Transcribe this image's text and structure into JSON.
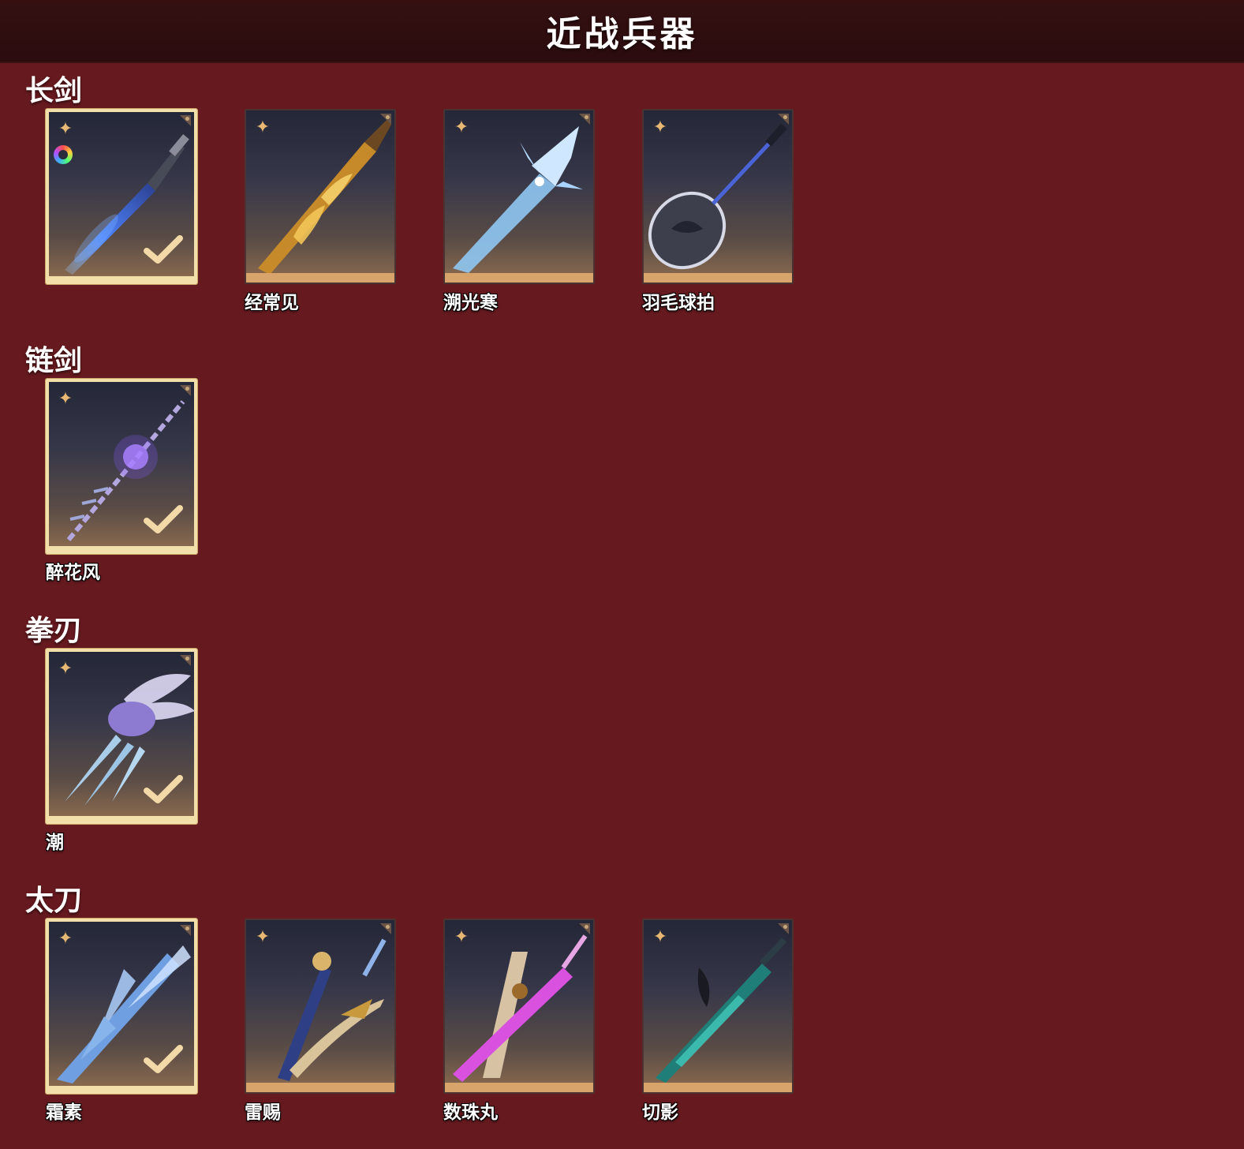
{
  "header": {
    "title": "近战兵器"
  },
  "sections": {
    "longsword": {
      "title": "长剑",
      "items": {
        "0": {
          "name": "",
          "icon": "blue-energy-sword-icon",
          "equipped": true,
          "variant_icon": "color-ring-icon"
        },
        "1": {
          "name": "经常见",
          "icon": "golden-script-sword-icon",
          "equipped": false
        },
        "2": {
          "name": "溯光寒",
          "icon": "ice-crystal-sword-icon",
          "equipped": false
        },
        "3": {
          "name": "羽毛球拍",
          "icon": "badminton-racket-icon",
          "equipped": false
        }
      }
    },
    "chainsword": {
      "title": "链剑",
      "items": {
        "0": {
          "name": "醉花风",
          "icon": "violet-chain-sword-icon",
          "equipped": true
        }
      }
    },
    "fistblade": {
      "title": "拳刃",
      "items": {
        "0": {
          "name": "潮",
          "icon": "winged-claw-blade-icon",
          "equipped": true
        }
      }
    },
    "katana": {
      "title": "太刀",
      "items": {
        "0": {
          "name": "霜素",
          "icon": "frost-katana-icon",
          "equipped": true
        },
        "1": {
          "name": "雷赐",
          "icon": "gold-ornate-katana-icon",
          "equipped": false
        },
        "2": {
          "name": "数珠丸",
          "icon": "magenta-glow-katana-icon",
          "equipped": false
        },
        "3": {
          "name": "切影",
          "icon": "teal-shadow-katana-icon",
          "equipped": false
        }
      }
    }
  },
  "colors": {
    "background": "#661a1f",
    "header_bar": "#2b0c0e",
    "equipped_border": "#f3dfaa",
    "card_bottom_strip": "#d8a46b",
    "accent_gold": "#e7b874"
  }
}
